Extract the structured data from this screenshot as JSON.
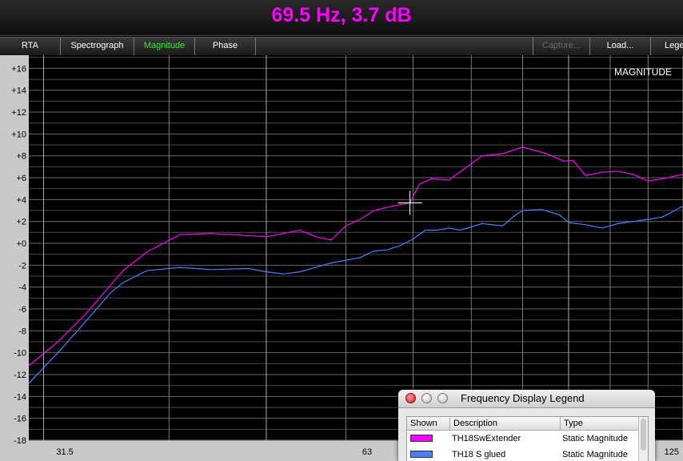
{
  "readout": {
    "text": "69.5 Hz, 3.7 dB",
    "color": "#ff00ff"
  },
  "tabs": [
    {
      "label": "RTA",
      "active": false,
      "disabled": false
    },
    {
      "label": "Spectrograph",
      "active": false,
      "disabled": false
    },
    {
      "label": "Magnitude",
      "active": true,
      "disabled": false
    },
    {
      "label": "Phase",
      "active": false,
      "disabled": false
    }
  ],
  "right_buttons": [
    {
      "label": "Capture...",
      "disabled": true
    },
    {
      "label": "Load...",
      "disabled": false
    },
    {
      "label": "Lege",
      "disabled": false
    }
  ],
  "active_tab_color": "#33ee33",
  "plot": {
    "mode_label": "MAGNITUDE",
    "y_ticks": [
      "+16",
      "+14",
      "+12",
      "+10",
      "+8",
      "+6",
      "+4",
      "+2",
      "+0",
      "-2",
      "-4",
      "-6",
      "-8",
      "-10",
      "-12",
      "-14",
      "-16",
      "-18"
    ],
    "x_ticks": [
      "31.5",
      "63",
      "125"
    ],
    "cursor": {
      "freq_hz": 69.5,
      "db": 3.7
    }
  },
  "chart_data": {
    "type": "line",
    "x_scale": "log",
    "xlim": [
      29,
      130
    ],
    "ylim": [
      -18,
      17.2
    ],
    "y_minor_step": 1,
    "grid": true,
    "series": [
      {
        "name": "TH18SwExtender",
        "color": "#ff00ff",
        "x": [
          29,
          31,
          33,
          35,
          36,
          38,
          41,
          44,
          50,
          54,
          56,
          58,
          60,
          62,
          64,
          66,
          69.5,
          71,
          73,
          76,
          79,
          82,
          86,
          90,
          95,
          99,
          101,
          104,
          108,
          112,
          116,
          120,
          124,
          130
        ],
        "y": [
          -11.2,
          -9,
          -6.5,
          -3.8,
          -2.5,
          -0.8,
          0.8,
          0.9,
          0.6,
          1.2,
          0.6,
          0.3,
          1.6,
          2.2,
          3,
          3.3,
          3.7,
          5.4,
          5.9,
          5.8,
          6.9,
          8,
          8.2,
          8.8,
          8.2,
          7.5,
          7.6,
          6.2,
          6.5,
          6.6,
          6.3,
          5.7,
          5.9,
          6.3
        ]
      },
      {
        "name": "TH18 S glued",
        "color": "#4a7fff",
        "x": [
          29,
          31,
          33,
          35,
          36,
          38,
          41,
          44,
          48,
          50,
          52,
          54,
          58,
          62,
          64,
          66,
          68,
          70,
          72,
          74,
          76,
          78,
          80,
          82,
          86,
          88,
          90,
          94,
          98,
          100,
          104,
          108,
          112,
          116,
          120,
          124,
          130
        ],
        "y": [
          -12.8,
          -10,
          -7.2,
          -4.5,
          -3.6,
          -2.5,
          -2.2,
          -2.4,
          -2.3,
          -2.6,
          -2.8,
          -2.6,
          -1.8,
          -1.3,
          -0.7,
          -0.6,
          -0.2,
          0.4,
          1.2,
          1.2,
          1.4,
          1.2,
          1.5,
          1.8,
          1.6,
          2.4,
          3,
          3.1,
          2.6,
          1.9,
          1.7,
          1.4,
          1.8,
          2,
          2.2,
          2.4,
          3.4
        ]
      }
    ]
  },
  "legend": {
    "title": "Frequency Display Legend",
    "columns": [
      "Shown",
      "Description",
      "Type"
    ],
    "rows": [
      {
        "color": "#ff00ff",
        "description": "TH18SwExtender",
        "type": "Static Magnitude"
      },
      {
        "color": "#4a7fff",
        "description": "TH18 S glued",
        "type": "Static Magnitude"
      }
    ]
  }
}
